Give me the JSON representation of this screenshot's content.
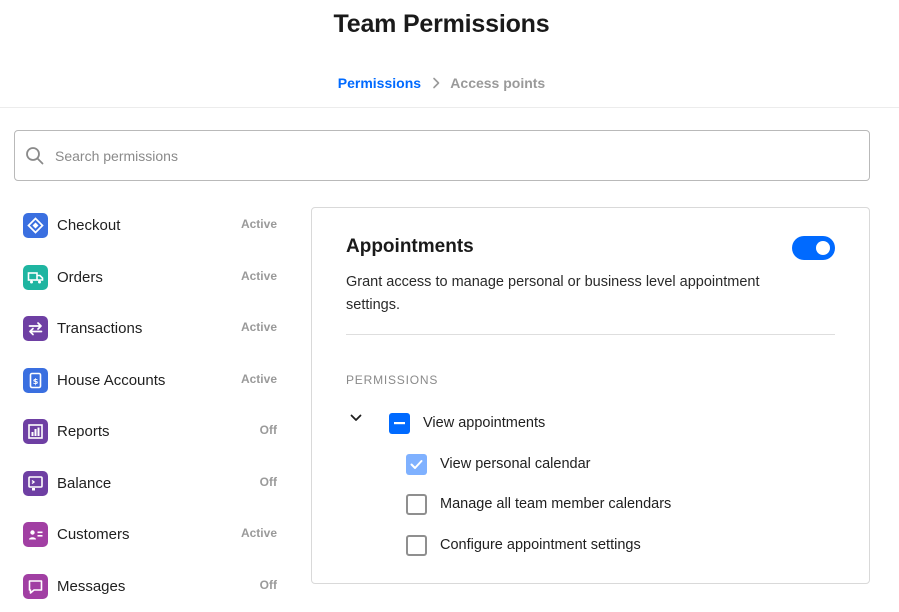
{
  "header": {
    "title": "Team Permissions",
    "breadcrumb": [
      "Permissions",
      "Access points"
    ]
  },
  "search": {
    "placeholder": "Search permissions",
    "value": ""
  },
  "sidebar": {
    "items": [
      {
        "label": "Checkout",
        "status": "Active",
        "icon": "checkout-icon",
        "color": "#3a6fe0"
      },
      {
        "label": "Orders",
        "status": "Active",
        "icon": "truck-icon",
        "color": "#1fb5a1"
      },
      {
        "label": "Transactions",
        "status": "Active",
        "icon": "arrows-swap-icon",
        "color": "#6e3fa3"
      },
      {
        "label": "House Accounts",
        "status": "Active",
        "icon": "dollar-document-icon",
        "color": "#3a6fe0"
      },
      {
        "label": "Reports",
        "status": "Off",
        "icon": "bar-chart-icon",
        "color": "#6e3fa3"
      },
      {
        "label": "Balance",
        "status": "Off",
        "icon": "terminal-icon",
        "color": "#6e3fa3"
      },
      {
        "label": "Customers",
        "status": "Active",
        "icon": "contact-card-icon",
        "color": "#a13fa3"
      },
      {
        "label": "Messages",
        "status": "Off",
        "icon": "message-icon",
        "color": "#a13fa3"
      }
    ]
  },
  "panel": {
    "title": "Appointments",
    "enabled": true,
    "description": "Grant access to manage personal or business level appointment settings.",
    "permissions_heading": "PERMISSIONS",
    "group": {
      "label": "View appointments",
      "state": "indeterminate",
      "expanded": true,
      "children": [
        {
          "label": "View personal calendar",
          "checked": true
        },
        {
          "label": "Manage all team member calendars",
          "checked": false
        },
        {
          "label": "Configure appointment settings",
          "checked": false
        }
      ]
    }
  },
  "colors": {
    "accent": "#006aff",
    "checked_light": "#7fb1ff",
    "muted": "#9a9a9a"
  }
}
